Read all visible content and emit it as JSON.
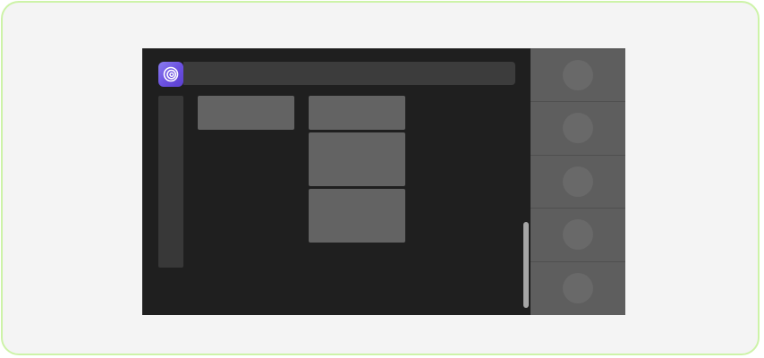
{
  "app": {
    "icon": "spiral-logo-icon",
    "brand_color": "#6a4fe0"
  },
  "right_panel": {
    "slots": [
      {
        "icon": "avatar-placeholder-icon"
      },
      {
        "icon": "avatar-placeholder-icon"
      },
      {
        "icon": "avatar-placeholder-icon"
      },
      {
        "icon": "avatar-placeholder-icon"
      },
      {
        "icon": "avatar-placeholder-icon"
      }
    ]
  }
}
